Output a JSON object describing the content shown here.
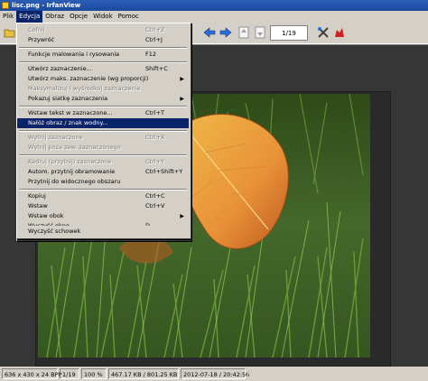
{
  "window": {
    "title": "lisc.png - IrfanView"
  },
  "menubar": [
    "Plik",
    "Edycja",
    "Obraz",
    "Opcje",
    "Widok",
    "Pomoc"
  ],
  "toolbar": {
    "page_indicator": "1/19"
  },
  "edit_menu": {
    "items": [
      {
        "label": "Cofnij",
        "shortcut": "Ctrl+Z",
        "disabled": true
      },
      {
        "label": "Przywróć",
        "shortcut": "Ctrl+J",
        "disabled": false
      },
      {
        "label": "Funkcje malowania i rysowania",
        "shortcut": "F12",
        "disabled": false
      },
      {
        "label": "Utwórz zaznaczenie...",
        "shortcut": "Shift+C",
        "disabled": false
      },
      {
        "label": "Utwórz maks. zaznaczenie (wg proporcji)",
        "shortcut": "",
        "disabled": false,
        "submenu": true
      },
      {
        "label": "Maksymalizuj i wyśrodkuj zaznaczenie",
        "shortcut": "",
        "disabled": true
      },
      {
        "label": "Pokazuj siatkę zaznaczenia",
        "shortcut": "",
        "disabled": false,
        "submenu": true
      },
      {
        "label": "Wstaw tekst w zaznaczone...",
        "shortcut": "Ctrl+T",
        "disabled": false
      },
      {
        "label": "Nałóż obraz / znak wodny...",
        "shortcut": "",
        "disabled": false,
        "highlighted": true
      },
      {
        "label": "Wytnij zaznaczone",
        "shortcut": "Ctrl+X",
        "disabled": true
      },
      {
        "label": "Wytnij poza zew. zaznaczonego",
        "shortcut": "",
        "disabled": true
      },
      {
        "label": "Kadruj (przytnij) zaznaczone",
        "shortcut": "Ctrl+Y",
        "disabled": true
      },
      {
        "label": "Autom. przytnij obramowanie",
        "shortcut": "Ctrl+Shift+Y",
        "disabled": false
      },
      {
        "label": "Przytnij do widocznego obszaru",
        "shortcut": "",
        "disabled": false
      },
      {
        "label": "Kopiuj",
        "shortcut": "Ctrl+C",
        "disabled": false
      },
      {
        "label": "Wstaw",
        "shortcut": "Ctrl+V",
        "disabled": false
      },
      {
        "label": "Wstaw obok",
        "shortcut": "",
        "disabled": false,
        "submenu": true
      },
      {
        "label": "Wyczyść okno",
        "shortcut": "D",
        "disabled": false
      },
      {
        "label": "Wyczyść schowek",
        "shortcut": "",
        "disabled": false
      }
    ]
  },
  "statusbar": {
    "dimensions": "636 x 430 x 24 BPP",
    "page": "1/19",
    "zoom": "100 %",
    "size": "467.17 KB / 801.25 KB",
    "datetime": "2012-07-18 / 20:42:56"
  },
  "colors": {
    "titlebar": "#1a4a9e",
    "highlight": "#0a246a",
    "canvas": "#363636"
  }
}
